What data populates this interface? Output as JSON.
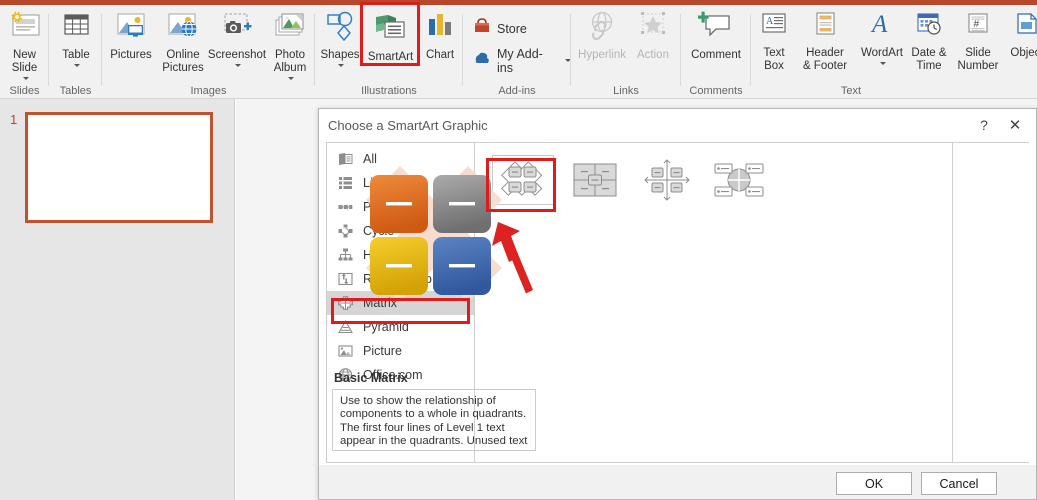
{
  "app": {
    "accent_red": "#b7472a",
    "annotation_red": "#e01b1b"
  },
  "ribbon": {
    "groups": [
      {
        "name": "slides",
        "label": "Slides"
      },
      {
        "name": "tables",
        "label": "Tables"
      },
      {
        "name": "images",
        "label": "Images"
      },
      {
        "name": "illustrations",
        "label": "Illustrations"
      },
      {
        "name": "addins",
        "label": "Add-ins"
      },
      {
        "name": "links",
        "label": "Links"
      },
      {
        "name": "comments",
        "label": "Comments"
      },
      {
        "name": "text",
        "label": "Text"
      }
    ],
    "buttons": {
      "new_slide": "New\nSlide",
      "table": "Table",
      "pictures": "Pictures",
      "online_pictures": "Online\nPictures",
      "screenshot": "Screenshot",
      "photo_album": "Photo\nAlbum",
      "shapes": "Shapes",
      "smartart": "SmartArt",
      "chart": "Chart",
      "store": "Store",
      "my_addins": "My Add-ins",
      "hyperlink": "Hyperlink",
      "action": "Action",
      "comment": "Comment",
      "text_box": "Text\nBox",
      "header_footer": "Header\n& Footer",
      "wordart": "WordArt",
      "date_time": "Date &\nTime",
      "slide_number": "Slide\nNumber",
      "object": "Object"
    }
  },
  "slide_panel": {
    "slide_number": "1"
  },
  "dialog": {
    "title": "Choose a SmartArt Graphic",
    "help_glyph": "?",
    "close_glyph": "✕",
    "categories": [
      {
        "label": "All",
        "icon": "all-icon",
        "selected": false
      },
      {
        "label": "List",
        "icon": "list-icon",
        "selected": false
      },
      {
        "label": "Process",
        "icon": "process-icon",
        "selected": false
      },
      {
        "label": "Cycle",
        "icon": "cycle-icon",
        "selected": false
      },
      {
        "label": "Hierarchy",
        "icon": "hierarchy-icon",
        "selected": false
      },
      {
        "label": "Relationship",
        "icon": "relationship-icon",
        "selected": false
      },
      {
        "label": "Matrix",
        "icon": "matrix-icon",
        "selected": true
      },
      {
        "label": "Pyramid",
        "icon": "pyramid-icon",
        "selected": false
      },
      {
        "label": "Picture",
        "icon": "picture-icon",
        "selected": false
      },
      {
        "label": "Office.com",
        "icon": "globe-icon",
        "selected": false
      }
    ],
    "gallery": [
      {
        "name": "basic-matrix",
        "selected": true
      },
      {
        "name": "titled-matrix",
        "selected": false
      },
      {
        "name": "grid-matrix",
        "selected": false
      },
      {
        "name": "cycle-matrix",
        "selected": false
      }
    ],
    "preview": {
      "title": "Basic Matrix",
      "description": "Use to show the relationship of components to a whole in quadrants. The first four lines of Level 1 text appear in the quadrants. Unused text does not appear, but remains available if you switch layouts.",
      "quadrant_colors": {
        "top_left": "#E06C1E",
        "top_right": "#8C8C8C",
        "bottom_left": "#E5B711",
        "bottom_right": "#3F6CB5",
        "backdrop": "#F7DDD0"
      }
    },
    "buttons": {
      "ok": "OK",
      "cancel": "Cancel"
    }
  },
  "annotations": {
    "smartart_highlight": true,
    "matrix_highlight": true,
    "basic_matrix_highlight": true,
    "arrow": true
  }
}
